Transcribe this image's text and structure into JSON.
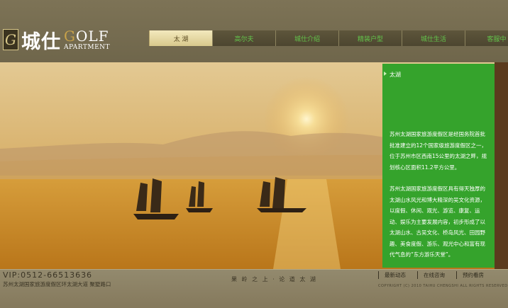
{
  "logo": {
    "mark": "G",
    "name_cn": "城仕",
    "golf_first": "G",
    "golf_rest": "OLF",
    "apartment": "APARTMENT"
  },
  "nav": {
    "items": [
      {
        "label": "太 湖",
        "active": true
      },
      {
        "label": "高尔夫",
        "active": false
      },
      {
        "label": "城仕介绍",
        "active": false
      },
      {
        "label": "精装户型",
        "active": false
      },
      {
        "label": "城仕生活",
        "active": false
      },
      {
        "label": "客服中",
        "active": false
      }
    ]
  },
  "panel": {
    "title": "太湖",
    "paragraph1": "苏州太湖国家旅游度假区是经国务院首批批准建立的12个国家级旅游度假区之一，位于苏州市区西南15公里的太湖之畔，规划核心区面积11.2平方公里。",
    "paragraph2": "苏州太湖国家旅游度假区具有得天独厚的太湖山水风光和博大精深的吴文化资源，以度假、休闲、观光、游览、康复、运动、娱乐为主要发展内容，初步形成了以太湖山水、古吴文化、桥岛风光、田园野趣、美食度假、游乐、观光中心和富有现代气息的“东方游乐天堂”。"
  },
  "footer": {
    "vip": "VIP:0512-66513636",
    "address": "苏州太湖国家旅游度假区环太湖大道 聚墅路口",
    "slogan": "果 岭 之 上 · 论 道 太 湖",
    "links": [
      "最新动态",
      "在线咨询",
      "预约看房"
    ],
    "copyright": "COPYRIGHT (C) 2010 TAIHU CHENGSHI ALL RIGHTS RESERVED"
  },
  "colors": {
    "accent_green": "#35a32c",
    "nav_text_green": "#63c54b",
    "active_tab": "#e6d9a4"
  }
}
